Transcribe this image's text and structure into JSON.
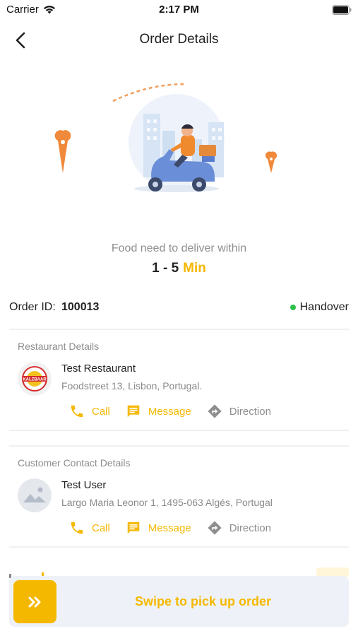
{
  "status_bar": {
    "carrier": "Carrier",
    "time": "2:17 PM"
  },
  "nav": {
    "title": "Order Details"
  },
  "delivery": {
    "label": "Food need to deliver within",
    "range": "1 - 5",
    "unit": "Min"
  },
  "order": {
    "id_label": "Order ID:",
    "id_value": "100013",
    "status": "Handover"
  },
  "restaurant": {
    "header": "Restaurant Details",
    "logo_text": "KALZBAAR",
    "name": "Test Restaurant",
    "address": "Foodstreet 13, Lisbon, Portugal.",
    "actions": {
      "call": "Call",
      "message": "Message",
      "direction": "Direction"
    }
  },
  "customer": {
    "header": "Customer Contact Details",
    "name": "Test User",
    "address": "Largo Maria Leonor 1, 1495-063 Algés, Portugal",
    "actions": {
      "call": "Call",
      "message": "Message",
      "direction": "Direction"
    }
  },
  "swipe": {
    "label": "Swipe to pick up order",
    "icon": "double-chevron-right-icon"
  },
  "colors": {
    "accent": "#f5b800",
    "status_dot": "#2fbf4b",
    "muted": "#8e8e8e"
  }
}
